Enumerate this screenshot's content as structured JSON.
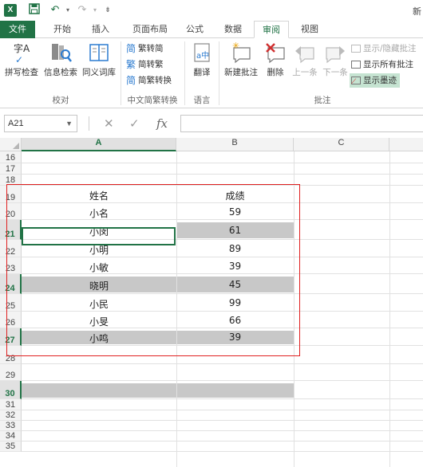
{
  "window": {
    "title_fragment": "新"
  },
  "app_icon_text": "X",
  "tabs": [
    {
      "label": "文件"
    },
    {
      "label": "开始"
    },
    {
      "label": "插入"
    },
    {
      "label": "页面布局"
    },
    {
      "label": "公式"
    },
    {
      "label": "数据"
    },
    {
      "label": "审阅"
    },
    {
      "label": "视图"
    }
  ],
  "ribbon": {
    "proofing": {
      "spell": "拼写检查",
      "research": "信息检索",
      "thesaurus": "同义词库",
      "group": "校对"
    },
    "chinese": {
      "to_simp": "繁转简",
      "to_trad": "简转繁",
      "convert": "简繁转换",
      "group": "中文简繁转换"
    },
    "language": {
      "translate": "翻译",
      "group": "语言"
    },
    "comments": {
      "new": "新建批注",
      "delete": "删除",
      "prev": "上一条",
      "next": "下一条",
      "show_hide": "显示/隐藏批注",
      "show_all": "显示所有批注",
      "show_ink": "显示墨迹",
      "group": "批注"
    },
    "icons": {
      "zi": "字",
      "jian": "简",
      "fan": "繁",
      "zi_a": "字A",
      "a_zhong": "a中"
    }
  },
  "formula_bar": {
    "name_box": "A21",
    "dropdown": "▼",
    "fx": "fx",
    "cancel": "✕",
    "enter": "✓",
    "value": ""
  },
  "columns": [
    "A",
    "B",
    "C"
  ],
  "rows": [
    "16",
    "17",
    "18",
    "19",
    "20",
    "21",
    "22",
    "23",
    "24",
    "25",
    "26",
    "27",
    "28",
    "29",
    "30",
    "31",
    "32",
    "33",
    "34",
    "35"
  ],
  "table": {
    "header": {
      "name": "姓名",
      "score": "成绩"
    },
    "records": [
      {
        "name": "小名",
        "score": "59"
      },
      {
        "name": "小闵",
        "score": "61"
      },
      {
        "name": "小明",
        "score": "89"
      },
      {
        "name": "小敏",
        "score": "39"
      },
      {
        "name": "晓明",
        "score": "45"
      },
      {
        "name": "小民",
        "score": "99"
      },
      {
        "name": "小旻",
        "score": "66"
      },
      {
        "name": "小鸣",
        "score": "39"
      }
    ]
  },
  "colors": {
    "accent": "#217346",
    "shade": "#c8c8c8",
    "annotation_border": "#e02020"
  }
}
